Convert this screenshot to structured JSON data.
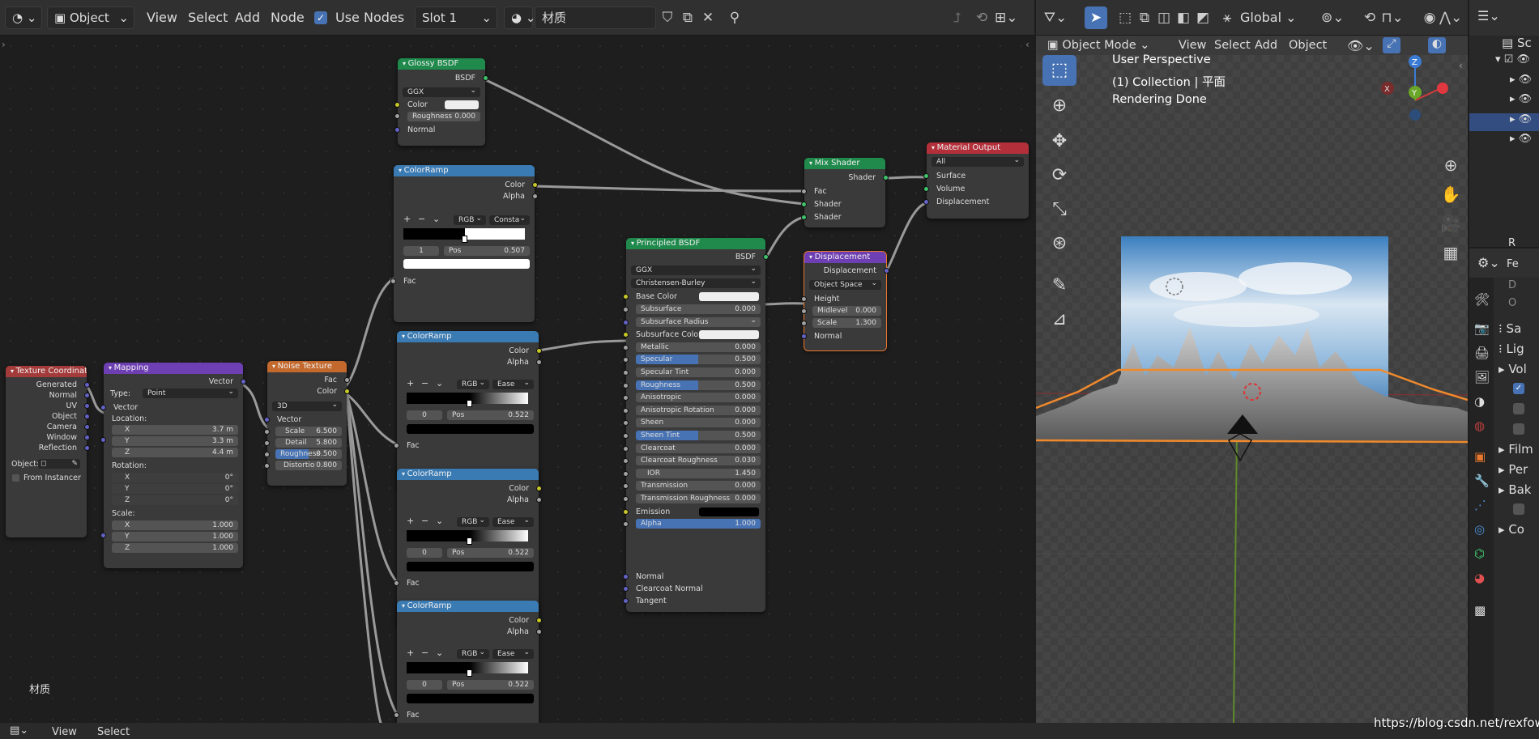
{
  "node_editor_header": {
    "editor_type_icon": "shader-editor-icon",
    "mode": "Object",
    "menus": [
      "View",
      "Select",
      "Add",
      "Node"
    ],
    "use_nodes_label": "Use Nodes",
    "use_nodes_checked": true,
    "slot": "Slot 1",
    "material_name": "材质"
  },
  "node_editor": {
    "material_label": "材质",
    "bottom_menus": [
      "View",
      "Select"
    ]
  },
  "nodes": {
    "glossy": {
      "title": "Glossy BSDF",
      "output": "BSDF",
      "distribution": "GGX",
      "color_label": "Color",
      "roughness_label": "Roughness",
      "roughness_value": "0.000",
      "normal_label": "Normal"
    },
    "ramp1": {
      "title": "ColorRamp",
      "out_color": "Color",
      "out_alpha": "Alpha",
      "mode": "RGB",
      "interp": "Consta",
      "index": "1",
      "pos_label": "Pos",
      "pos_value": "0.507",
      "fac": "Fac"
    },
    "ramp2": {
      "title": "ColorRamp",
      "out_color": "Color",
      "out_alpha": "Alpha",
      "mode": "RGB",
      "interp": "Ease",
      "index": "0",
      "pos_label": "Pos",
      "pos_value": "0.522",
      "fac": "Fac"
    },
    "ramp3": {
      "title": "ColorRamp",
      "out_color": "Color",
      "out_alpha": "Alpha",
      "mode": "RGB",
      "interp": "Ease",
      "index": "0",
      "pos_label": "Pos",
      "pos_value": "0.522",
      "fac": "Fac"
    },
    "ramp4": {
      "title": "ColorRamp",
      "out_color": "Color",
      "out_alpha": "Alpha",
      "mode": "RGB",
      "interp": "Ease",
      "index": "0",
      "pos_label": "Pos",
      "pos_value": "0.522",
      "fac": "Fac"
    },
    "texcoord": {
      "title": "Texture Coordinate",
      "outputs": [
        "Generated",
        "Normal",
        "UV",
        "Object",
        "Camera",
        "Window",
        "Reflection"
      ],
      "object_label": "Object:",
      "from_instancer": "From Instancer"
    },
    "mapping": {
      "title": "Mapping",
      "output": "Vector",
      "type_label": "Type:",
      "type_value": "Point",
      "vector": "Vector",
      "location": "Location:",
      "loc": [
        [
          "X",
          "3.7 m"
        ],
        [
          "Y",
          "3.3 m"
        ],
        [
          "Z",
          "4.4 m"
        ]
      ],
      "rotation": "Rotation:",
      "rot": [
        [
          "X",
          "0°"
        ],
        [
          "Y",
          "0°"
        ],
        [
          "Z",
          "0°"
        ]
      ],
      "scale": "Scale:",
      "scl": [
        [
          "X",
          "1.000"
        ],
        [
          "Y",
          "1.000"
        ],
        [
          "Z",
          "1.000"
        ]
      ]
    },
    "noise": {
      "title": "Noise Texture",
      "out_fac": "Fac",
      "out_color": "Color",
      "dims": "3D",
      "vector": "Vector",
      "fields": [
        [
          "Scale",
          "6.500"
        ],
        [
          "Detail",
          "5.800"
        ],
        [
          "Roughness",
          "0.500"
        ],
        [
          "Distortio",
          "0.800"
        ]
      ]
    },
    "principled": {
      "title": "Principled BSDF",
      "output": "BSDF",
      "distribution": "GGX",
      "subsurface_method": "Christensen-Burley",
      "base_color": "Base Color",
      "fields": [
        [
          "Subsurface",
          "0.000"
        ],
        [
          "Subsurface Radius",
          ""
        ],
        [
          "Subsurface Color",
          ""
        ],
        [
          "Metallic",
          "0.000"
        ],
        [
          "Specular",
          "0.500"
        ],
        [
          "Specular Tint",
          "0.000"
        ],
        [
          "Roughness",
          "0.500"
        ],
        [
          "Anisotropic",
          "0.000"
        ],
        [
          "Anisotropic Rotation",
          "0.000"
        ],
        [
          "Sheen",
          "0.000"
        ],
        [
          "Sheen Tint",
          "0.500"
        ],
        [
          "Clearcoat",
          "0.000"
        ],
        [
          "Clearcoat Roughness",
          "0.030"
        ],
        [
          "IOR",
          "1.450"
        ],
        [
          "Transmission",
          "0.000"
        ],
        [
          "Transmission Roughness",
          "0.000"
        ],
        [
          "Emission",
          ""
        ],
        [
          "Alpha",
          "1.000"
        ]
      ],
      "tail": [
        "Normal",
        "Clearcoat Normal",
        "Tangent"
      ]
    },
    "mix": {
      "title": "Mix Shader",
      "output": "Shader",
      "inputs": [
        "Fac",
        "Shader",
        "Shader"
      ]
    },
    "output": {
      "title": "Material Output",
      "target": "All",
      "inputs": [
        "Surface",
        "Volume",
        "Displacement"
      ]
    },
    "displacement": {
      "title": "Displacement",
      "output": "Displacement",
      "space": "Object Space",
      "height": "Height",
      "midlevel_label": "Midlevel",
      "midlevel": "0.000",
      "scale_label": "Scale",
      "scale": "1.300",
      "normal": "Normal"
    }
  },
  "viewport_header": {
    "transform": "Global",
    "mode": "Object Mode",
    "menus": [
      "View",
      "Select",
      "Add",
      "Object"
    ]
  },
  "viewport": {
    "perspective": "User Perspective",
    "collection": "(1) Collection | 平面",
    "status": "Rendering Done"
  },
  "properties_panel": {
    "rows": [
      "Sa",
      "Lig",
      "Vol",
      "Film",
      "Per",
      "Bak",
      "Co"
    ],
    "top_letters": [
      "R",
      "Fe",
      "D",
      "O"
    ]
  },
  "watermark": "https://blog.csdn.net/rexfow",
  "colors": {
    "input_node": "#a33b3b",
    "vector_node": "#6e3fb3",
    "texture_node": "#c4692d",
    "shader_node": "#1f8a4c",
    "converter_node": "#3b7bb3",
    "output_node": "#b3303b",
    "selected": "#4772b3"
  }
}
